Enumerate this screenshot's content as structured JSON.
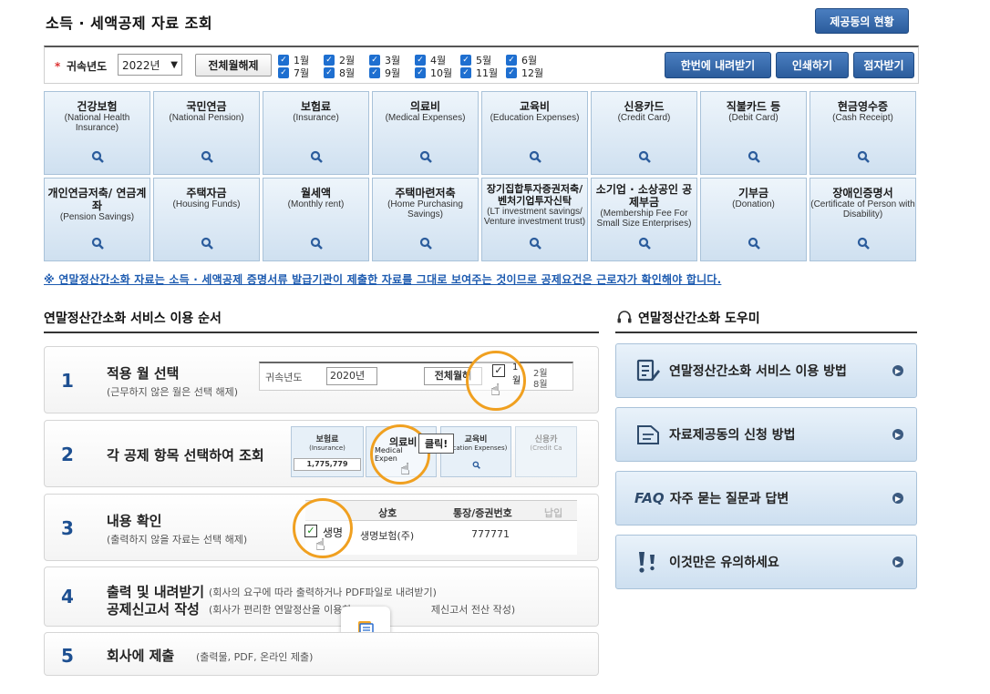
{
  "header": {
    "title": "소득 · 세액공제 자료 조회",
    "provider_button": "제공동의 현황"
  },
  "filter": {
    "required_mark": "*",
    "year_label": "귀속년도",
    "year_value": "2022년",
    "clear_button": "전체월해제",
    "months": [
      "1월",
      "2월",
      "3월",
      "4월",
      "5월",
      "6월",
      "7월",
      "8월",
      "9월",
      "10월",
      "11월",
      "12월"
    ],
    "bulk_download": "한번에 내려받기",
    "print": "인쇄하기",
    "braille": "점자받기"
  },
  "categories": [
    {
      "title": "건강보험",
      "en": "(National Health Insurance)"
    },
    {
      "title": "국민연금",
      "en": "(National Pension)"
    },
    {
      "title": "보험료",
      "en": "(Insurance)"
    },
    {
      "title": "의료비",
      "en": "(Medical Expenses)"
    },
    {
      "title": "교육비",
      "en": "(Education Expenses)"
    },
    {
      "title": "신용카드",
      "en": "(Credit Card)"
    },
    {
      "title": "직불카드 등",
      "en": "(Debit Card)"
    },
    {
      "title": "현금영수증",
      "en": "(Cash Receipt)"
    },
    {
      "title": "개인연금저축/ 연금계좌",
      "en": "(Pension Savings)"
    },
    {
      "title": "주택자금",
      "en": "(Housing Funds)"
    },
    {
      "title": "월세액",
      "en": "(Monthly rent)"
    },
    {
      "title": "주택마련저축",
      "en": "(Home Purchasing Savings)"
    },
    {
      "title": "장기집합투자증권저축/ 벤처기업투자신탁",
      "en": "(LT investment savings/ Venture investment trust)"
    },
    {
      "title": "소기업 · 소상공인 공제부금",
      "en": "(Membership Fee For Small Size Enterprises)"
    },
    {
      "title": "기부금",
      "en": "(Donation)"
    },
    {
      "title": "장애인증명서",
      "en": "(Certificate of Person with Disability)"
    }
  ],
  "notice": "※ 연말정산간소화 자료는 소득 · 세액공제 증명서류 발급기관이 제출한 자료를 그대로 보여주는 것이므로 공제요건은 근로자가 확인해야 합니다.",
  "guide": {
    "title": "연말정산간소화 서비스 이용 순서",
    "steps": [
      {
        "num": "1",
        "title": "적용 월 선택",
        "desc": "(근무하지 않은 월은 선택 해제)"
      },
      {
        "num": "2",
        "title": "각 공제 항목 선택하여 조회",
        "desc": ""
      },
      {
        "num": "3",
        "title": "내용 확인",
        "desc": "(출력하지 않을 자료는 선택 해제)"
      },
      {
        "num": "4",
        "title": "출력 및 내려받기",
        "desc": "(회사의 요구에 따라 출력하거나 PDF파일로 내려받기)",
        "title2": "공제신고서 작성",
        "desc2": "(회사가 편리한 연말정산을 이용하                         제신고서 전산 작성)"
      },
      {
        "num": "5",
        "title": "회사에 제출",
        "desc": "(출력물, PDF, 온라인 제출)"
      }
    ],
    "illus1": {
      "label": "귀속년도",
      "year": "2020년",
      "btn": "전체월해",
      "m1": "1월",
      "m2": "2월",
      "m7": "7월",
      "m8": "8월"
    },
    "illus2": {
      "c1": "보험료",
      "c1e": "(Insurance)",
      "c1v": "1,775,779",
      "c2": "의료비",
      "c2e": "Medical Expen",
      "click": "클릭!",
      "c3": "교육비",
      "c3e": "ducation Expenses)",
      "c4": "신용카",
      "c4e": "(Credit Ca"
    },
    "illus3": {
      "h1": "상호",
      "h2": "통장/증권번호",
      "h3": "납입",
      "row_label": "생명",
      "row_name": "생명보험(주)",
      "row_no": "777771"
    }
  },
  "helper": {
    "title": "연말정산간소화 도우미",
    "items": [
      {
        "label": "연말정산간소화 서비스 이용 방법",
        "icon": "edit-icon"
      },
      {
        "label": "자료제공동의 신청 방법",
        "icon": "document-icon"
      },
      {
        "label": "자주 묻는 질문과 답변",
        "icon": "faq-icon",
        "prefix": "FAQ"
      },
      {
        "label": "이것만은 유의하세요",
        "icon": "exclamation-icon"
      }
    ]
  }
}
